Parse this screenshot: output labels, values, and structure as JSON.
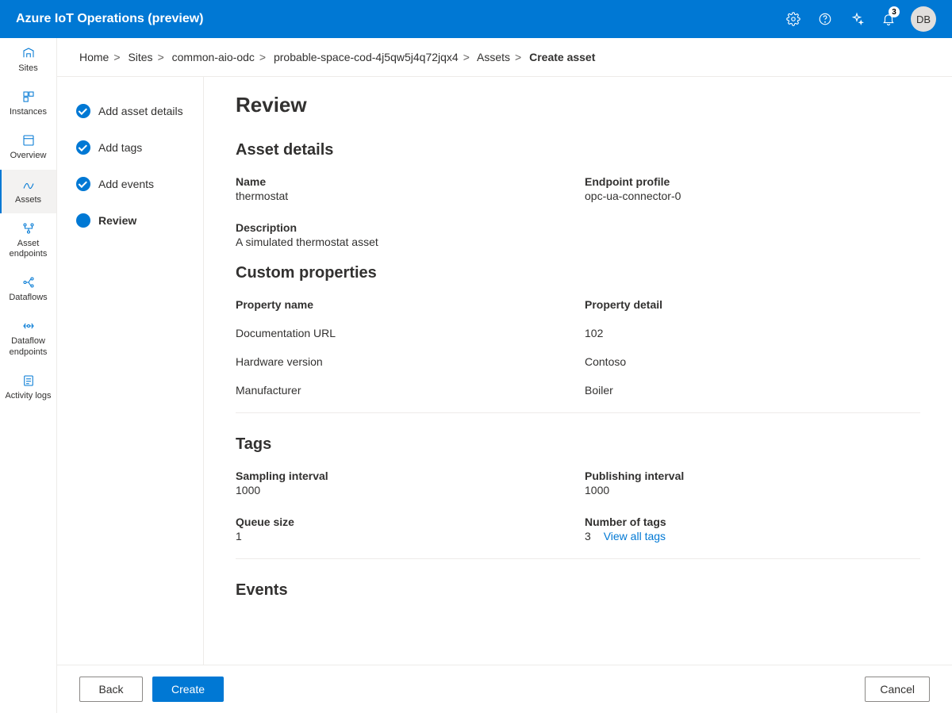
{
  "topbar": {
    "title": "Azure IoT Operations (preview)",
    "notification_count": "3",
    "avatar_initials": "DB"
  },
  "leftnav": {
    "items": [
      {
        "label": "Sites"
      },
      {
        "label": "Instances"
      },
      {
        "label": "Overview"
      },
      {
        "label": "Assets"
      },
      {
        "label": "Asset endpoints"
      },
      {
        "label": "Dataflows"
      },
      {
        "label": "Dataflow endpoints"
      },
      {
        "label": "Activity logs"
      }
    ]
  },
  "breadcrumb": {
    "items": [
      "Home",
      "Sites",
      "common-aio-odc",
      "probable-space-cod-4j5qw5j4q72jqx4",
      "Assets"
    ],
    "current": "Create asset"
  },
  "wizard": {
    "steps": [
      {
        "label": "Add asset details",
        "state": "done"
      },
      {
        "label": "Add tags",
        "state": "done"
      },
      {
        "label": "Add events",
        "state": "done"
      },
      {
        "label": "Review",
        "state": "current"
      }
    ]
  },
  "review": {
    "title": "Review",
    "asset_details": {
      "heading": "Asset details",
      "name_label": "Name",
      "name_value": "thermostat",
      "endpoint_label": "Endpoint profile",
      "endpoint_value": "opc-ua-connector-0",
      "description_label": "Description",
      "description_value": "A simulated thermostat asset"
    },
    "custom_properties": {
      "heading": "Custom properties",
      "col_name": "Property name",
      "col_detail": "Property detail",
      "rows": [
        {
          "name": "Documentation URL",
          "detail": "102"
        },
        {
          "name": "Hardware version",
          "detail": "Contoso"
        },
        {
          "name": "Manufacturer",
          "detail": "Boiler"
        }
      ]
    },
    "tags": {
      "heading": "Tags",
      "sampling_label": "Sampling interval",
      "sampling_value": "1000",
      "publishing_label": "Publishing interval",
      "publishing_value": "1000",
      "queue_label": "Queue size",
      "queue_value": "1",
      "number_label": "Number of tags",
      "number_value": "3",
      "view_all": "View all tags"
    },
    "events": {
      "heading": "Events"
    }
  },
  "footer": {
    "back": "Back",
    "create": "Create",
    "cancel": "Cancel"
  }
}
